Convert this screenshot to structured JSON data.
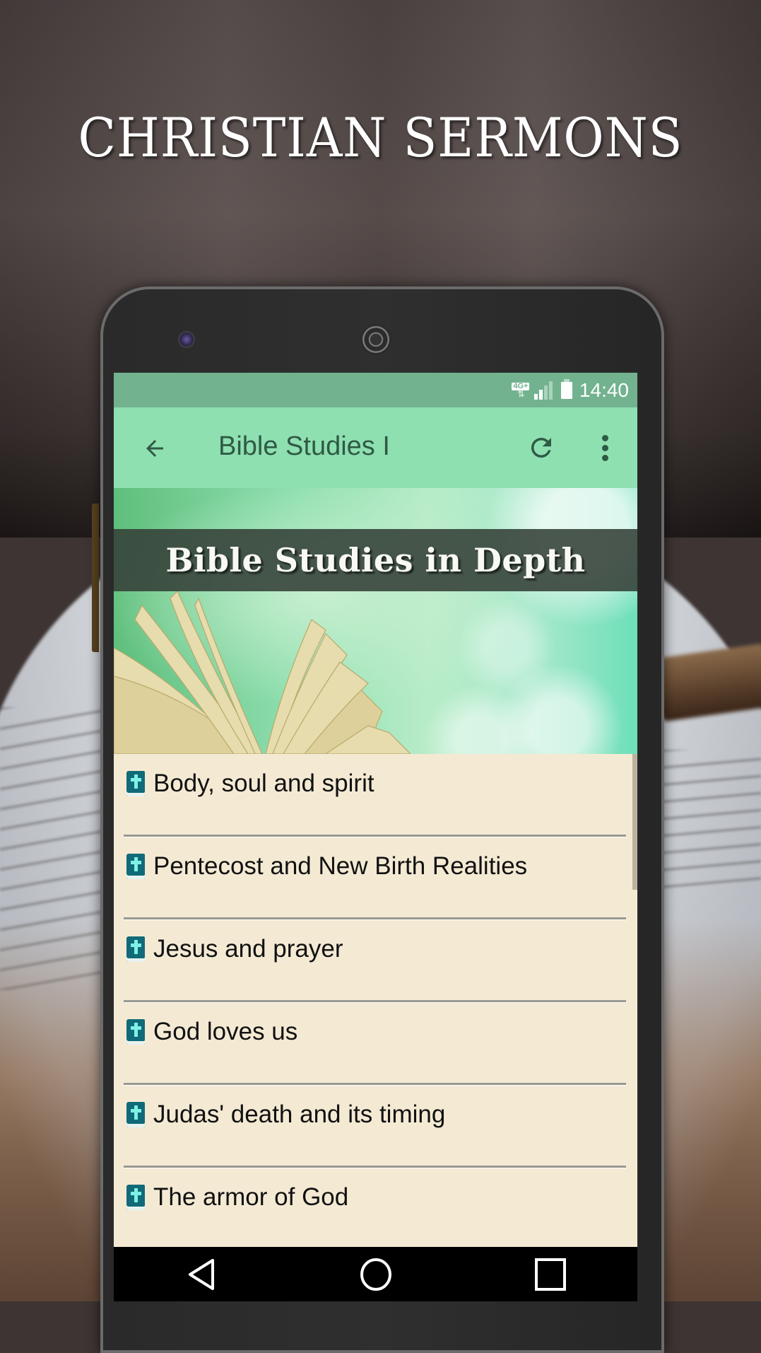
{
  "promo": {
    "headline": "CHRISTIAN SERMONS"
  },
  "status_bar": {
    "network_label": "4G+",
    "time": "14:40"
  },
  "toolbar": {
    "title": "Bible Studies I",
    "back_icon": "arrow-back-icon",
    "refresh_icon": "refresh-icon",
    "more_icon": "more-vert-icon"
  },
  "banner": {
    "title": "Bible Studies in Depth"
  },
  "list": {
    "items": [
      {
        "label": "Body, soul and spirit",
        "icon": "bible-icon"
      },
      {
        "label": "Pentecost and New Birth Realities",
        "icon": "bible-icon"
      },
      {
        "label": "Jesus and prayer",
        "icon": "bible-icon"
      },
      {
        "label": "God loves us",
        "icon": "bible-icon"
      },
      {
        "label": "Judas' death and its timing",
        "icon": "bible-icon"
      },
      {
        "label": "The armor of God",
        "icon": "bible-icon"
      }
    ]
  },
  "nav_bar": {
    "back": "nav-back-icon",
    "home": "nav-home-icon",
    "recents": "nav-recents-icon"
  },
  "colors": {
    "status_bar": "#72b28f",
    "toolbar": "#8fe0b1",
    "toolbar_text": "#2f5a45",
    "list_background": "#f4ead4",
    "bible_icon": "#116a78"
  }
}
